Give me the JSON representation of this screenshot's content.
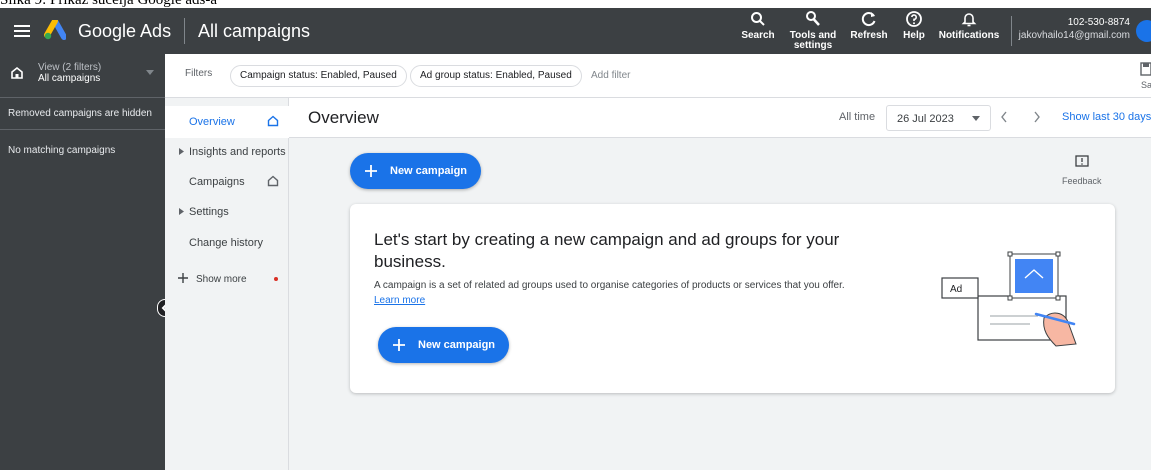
{
  "caption": "Slika 9: Prikaz sučelja Google ads-a",
  "topbar": {
    "brand": "Google Ads",
    "page_title": "All campaigns",
    "tools": [
      {
        "label": "Search",
        "icon": "search-icon"
      },
      {
        "label": "Tools and settings",
        "icon": "wrench-icon"
      },
      {
        "label": "Refresh",
        "icon": "refresh-icon"
      },
      {
        "label": "Help",
        "icon": "help-icon"
      },
      {
        "label": "Notifications",
        "icon": "bell-icon"
      }
    ],
    "account_id": "102-530-8874",
    "account_email": "jakovhailo14@gmail.com"
  },
  "left_panel": {
    "view_title": "View (2 filters)",
    "view_sub": "All campaigns",
    "removed_hidden": "Removed campaigns are hidden",
    "no_matching": "No matching campaigns"
  },
  "filters": {
    "label": "Filters",
    "chips": [
      "Campaign status: Enabled, Paused",
      "Ad group status: Enabled, Paused"
    ],
    "add_filter": "Add filter",
    "save_label": "Sa"
  },
  "nav": {
    "items": [
      {
        "label": "Overview",
        "active": true,
        "home": true
      },
      {
        "label": "Insights and reports",
        "expandable": true
      },
      {
        "label": "Campaigns",
        "home": true
      },
      {
        "label": "Settings",
        "expandable": true
      },
      {
        "label": "Change history"
      }
    ],
    "show_more": "Show more"
  },
  "main": {
    "title": "Overview",
    "all_time": "All time",
    "date": "26 Jul 2023",
    "show_last": "Show last 30 days",
    "new_campaign": "New campaign",
    "feedback": "Feedback",
    "card": {
      "heading": "Let's start by creating a new campaign and ad groups for your business.",
      "description": "A campaign is a set of related ad groups used to organise categories of products or services that you offer.",
      "learn_more": "Learn more",
      "button": "New campaign",
      "ad_label": "Ad"
    }
  },
  "colors": {
    "topbar": "#3c4043",
    "accent": "#1a73e8",
    "nav_bg": "#f1f3f4",
    "dot": "#d93025"
  }
}
